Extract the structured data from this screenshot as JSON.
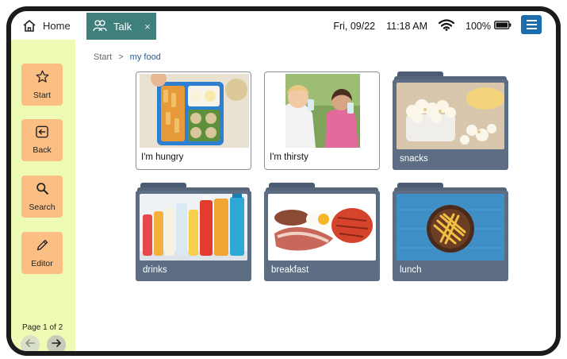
{
  "topbar": {
    "home_label": "Home",
    "tab_label": "Talk",
    "tab_close": "×",
    "date": "Fri, 09/22",
    "time": "11:18 AM",
    "battery": "100%"
  },
  "sidebar": {
    "items": [
      {
        "label": "Start",
        "icon": "star-icon"
      },
      {
        "label": "Back",
        "icon": "back-icon"
      },
      {
        "label": "Search",
        "icon": "search-icon"
      },
      {
        "label": "Editor",
        "icon": "pencil-icon"
      }
    ],
    "page_label": "Page 1 of 2"
  },
  "breadcrumb": {
    "root": "Start",
    "separator": ">",
    "current": "my food"
  },
  "tiles": [
    {
      "label": "I'm hungry",
      "kind": "card"
    },
    {
      "label": "I'm thirsty",
      "kind": "card"
    },
    {
      "label": "snacks",
      "kind": "folder"
    },
    {
      "label": "drinks",
      "kind": "folder"
    },
    {
      "label": "breakfast",
      "kind": "folder"
    },
    {
      "label": "lunch",
      "kind": "folder"
    }
  ],
  "colors": {
    "talk_tab": "#3f7f7c",
    "sidebar_bg": "#eefbb4",
    "sidebar_button": "#fcbf83",
    "folder": "#5d6d84",
    "menu_button": "#1a6eb0",
    "breadcrumb_current": "#1f5fa8"
  }
}
